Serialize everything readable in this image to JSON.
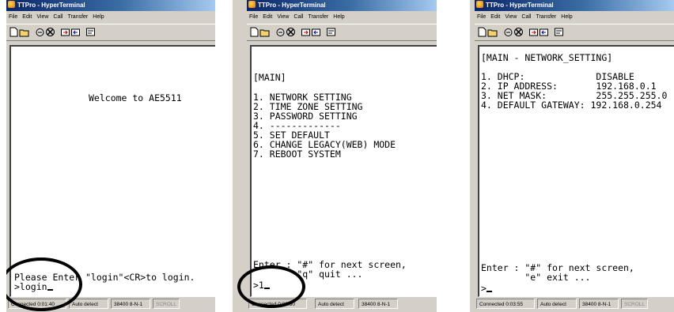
{
  "windows": [
    {
      "title": "TTPro - HyperTerminal",
      "menu": [
        "File",
        "Edit",
        "View",
        "Call",
        "Transfer",
        "Help"
      ],
      "terminal_lines": [
        "Welcome to AE5511",
        "Please Enter \"login\"<CR>to login.",
        ">login"
      ],
      "status": {
        "connected": "Connected 0:01:40",
        "detect": "Auto detect",
        "port": "38400 8-N-1",
        "scroll": "SCROLL"
      }
    },
    {
      "title": "TTPro - HyperTerminal",
      "menu": [
        "File",
        "Edit",
        "View",
        "Call",
        "Transfer",
        "Help"
      ],
      "terminal_lines": [
        "[MAIN]",
        "1. NETWORK SETTING",
        "2. TIME ZONE SETTING",
        "3. PASSWORD SETTING",
        "4. -------------",
        "5. SET DEFAULT",
        "6. CHANGE LEGACY(WEB) MODE",
        "7. REBOOT SYSTEM",
        "Enter : \"#\" for next screen,",
        "        \"q\" quit ...",
        ">1"
      ],
      "status": {
        "connected": "Connected 0:02:30",
        "detect": "Auto detect",
        "port": "38400 8-N-1"
      }
    },
    {
      "title": "TTPro - HyperTerminal",
      "menu": [
        "File",
        "Edit",
        "View",
        "Call",
        "Transfer",
        "Help"
      ],
      "terminal_lines": [
        "[MAIN - NETWORK_SETTING]",
        "1. DHCP:             DISABLE",
        "2. IP ADDRESS:       192.168.0.1",
        "3. NET MASK:         255.255.255.0",
        "4. DEFAULT GATEWAY: 192.168.0.254",
        "Enter : \"#\" for next screen,",
        "        \"e\" exit ...",
        ">"
      ],
      "status": {
        "connected": "Connected 0:03:55",
        "detect": "Auto detect",
        "port": "38400 8-N-1",
        "scroll": "SCROLL"
      }
    }
  ],
  "icons": [
    "new-icon",
    "open-icon",
    "connect-icon",
    "disconnect-icon",
    "send-icon",
    "receive-icon",
    "properties-icon"
  ]
}
